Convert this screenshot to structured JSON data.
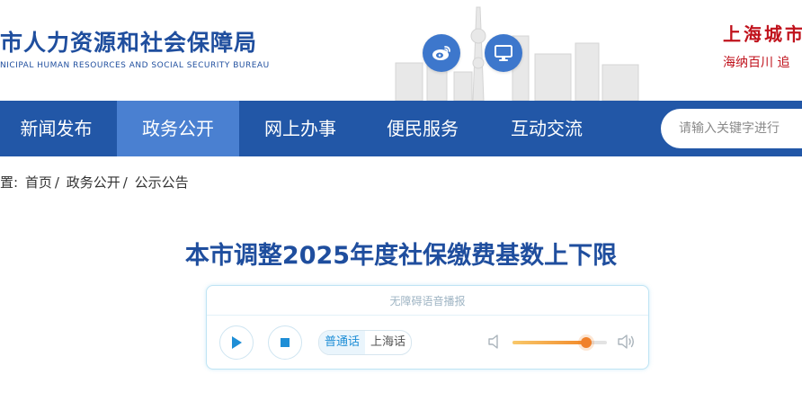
{
  "header": {
    "title": "市人力资源和社会保障局",
    "subtitle": "NICIPAL HUMAN RESOURCES AND SOCIAL SECURITY BUREAU",
    "slogan_line1": "上海城市",
    "slogan_line2": "海纳百川 追"
  },
  "nav": {
    "items": [
      {
        "label": "新闻发布"
      },
      {
        "label": "政务公开"
      },
      {
        "label": "网上办事"
      },
      {
        "label": "便民服务"
      },
      {
        "label": "互动交流"
      }
    ],
    "active_index": 1
  },
  "search": {
    "placeholder": "请输入关键字进行"
  },
  "breadcrumb": {
    "prefix": "置:",
    "items": [
      "首页",
      "政务公开",
      "公示公告"
    ],
    "separator": "/"
  },
  "article": {
    "title": "本市调整2025年度社保缴费基数上下限"
  },
  "player": {
    "label": "无障碍语音播报",
    "languages": [
      "普通话",
      "上海话"
    ],
    "selected_language": "普通话",
    "volume_level": 0.78
  },
  "colors": {
    "nav_bg": "#2257a7",
    "nav_active": "#4a80d1",
    "title_blue": "#1f4e9e",
    "slogan_red": "#c0121c",
    "slider_orange": "#f0802a"
  }
}
